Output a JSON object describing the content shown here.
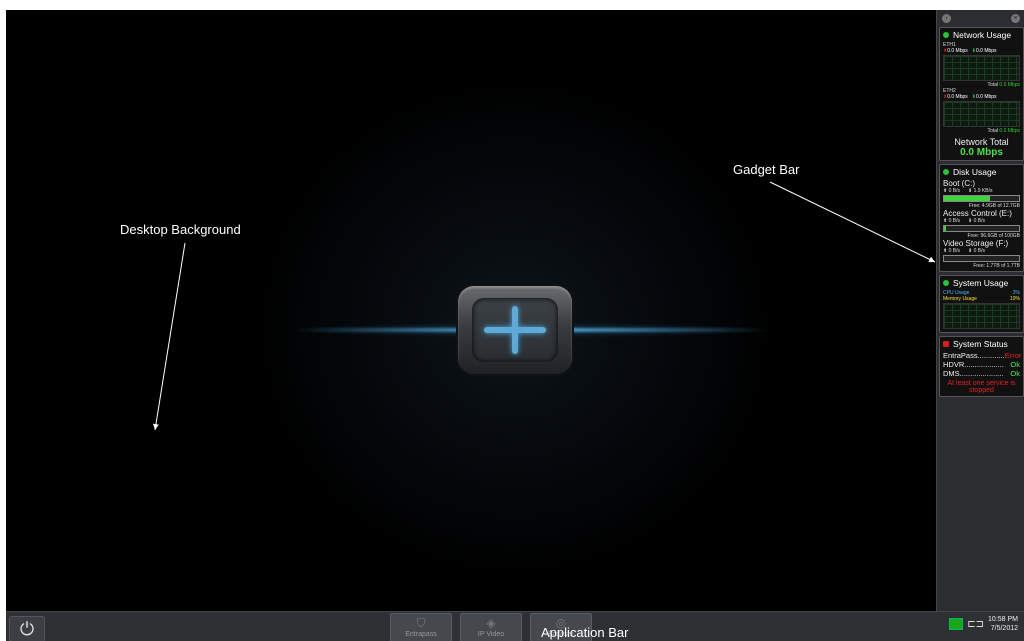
{
  "annotations": {
    "desktop_background": "Desktop Background",
    "gadget_bar": "Gadget Bar",
    "application_bar": "Application Bar"
  },
  "gadgets": {
    "network": {
      "title": "Network Usage",
      "eth1": {
        "name": "ETH1",
        "up": "0.0 Mbps",
        "down": "0.0 Mbps",
        "total_label": "Total",
        "total": "0.0 Mbps"
      },
      "eth2": {
        "name": "ETH2",
        "up": "0.0 Mbps",
        "down": "0.0 Mbps",
        "total_label": "Total",
        "total": "0.0 Mbps"
      },
      "network_total_label": "Network Total",
      "network_total": "0.0 Mbps"
    },
    "disk": {
      "title": "Disk Usage",
      "drives": [
        {
          "label": "Boot (C:)",
          "read": "0 B/s",
          "write": "1.9 KB/s",
          "fill": 0.61,
          "free": "Free: 4.9GB of 12.7GB"
        },
        {
          "label": "Access Control (E:)",
          "read": "0 B/s",
          "write": "0 B/s",
          "fill": 0.03,
          "free": "Free: 96.6GB of 100GB"
        },
        {
          "label": "Video Storage (F:)",
          "read": "0 B/s",
          "write": "0 B/s",
          "fill": 0.0,
          "free": "Free: 1.7TB of 1.7TB"
        }
      ]
    },
    "system_usage": {
      "title": "System Usage",
      "cpu_label": "CPU Usage",
      "cpu": "3%",
      "mem_label": "Memory Usage",
      "mem": "19%"
    },
    "system_status": {
      "title": "System Status",
      "services": [
        {
          "name": "EntraPass.............",
          "state": "Error"
        },
        {
          "name": "HDVR...................",
          "state": "Ok"
        },
        {
          "name": "DMS.....................",
          "state": "Ok"
        }
      ],
      "warning": "At least one service is stopped"
    }
  },
  "taskbar": {
    "apps": [
      {
        "label": "Entrapass",
        "icon": "shield-icon"
      },
      {
        "label": "IP Video",
        "icon": "camera-icon"
      },
      {
        "label": "Browser",
        "icon": "globe-icon"
      }
    ],
    "time": "10:58 PM",
    "date": "7/5/2012"
  },
  "colors": {
    "accent_blue": "#5fa9d7",
    "ok_green": "#5de05d",
    "error_red": "#e02020"
  }
}
